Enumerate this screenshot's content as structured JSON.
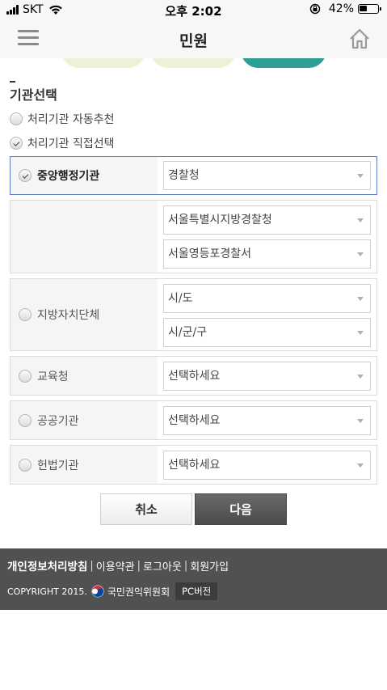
{
  "status_bar": {
    "carrier": "SKT",
    "time": "오후 2:02",
    "battery_percent": "42%",
    "battery_level": 0.42
  },
  "header": {
    "title": "민원",
    "menu_icon": "hamburger-menu-icon",
    "home_icon": "home-icon"
  },
  "section": {
    "title": "기관선택",
    "options": [
      {
        "label": "처리기관 자동추천",
        "checked": false
      },
      {
        "label": "처리기관 직접선택",
        "checked": true
      }
    ]
  },
  "agencies": {
    "central": {
      "label": "중앙행정기관",
      "select": "경찰청",
      "sub_select_1": "서울특별시지방경찰청",
      "sub_select_2": "서울영등포경찰서"
    },
    "local": {
      "label": "지방자치단체",
      "select_1": "시/도",
      "select_2": "시/군/구"
    },
    "education": {
      "label": "교육청",
      "select": "선택하세요"
    },
    "public": {
      "label": "공공기관",
      "select": "선택하세요"
    },
    "constitutional": {
      "label": "헌법기관",
      "select": "선택하세요"
    }
  },
  "buttons": {
    "cancel": "취소",
    "next": "다음"
  },
  "footer": {
    "privacy": "개인정보처리방침",
    "sep": "|",
    "terms": "이용약관",
    "logout": "로그아웃",
    "join": "회원가입",
    "copyright": "COPYRIGHT 2015.",
    "org": "국민권익위원회",
    "pc_version": "PC버전"
  },
  "colors": {
    "accent_teal": "#2f9e94",
    "tab_cream": "#eef0d8",
    "selected_border": "#5b7fc0",
    "footer_bg": "#505152"
  }
}
